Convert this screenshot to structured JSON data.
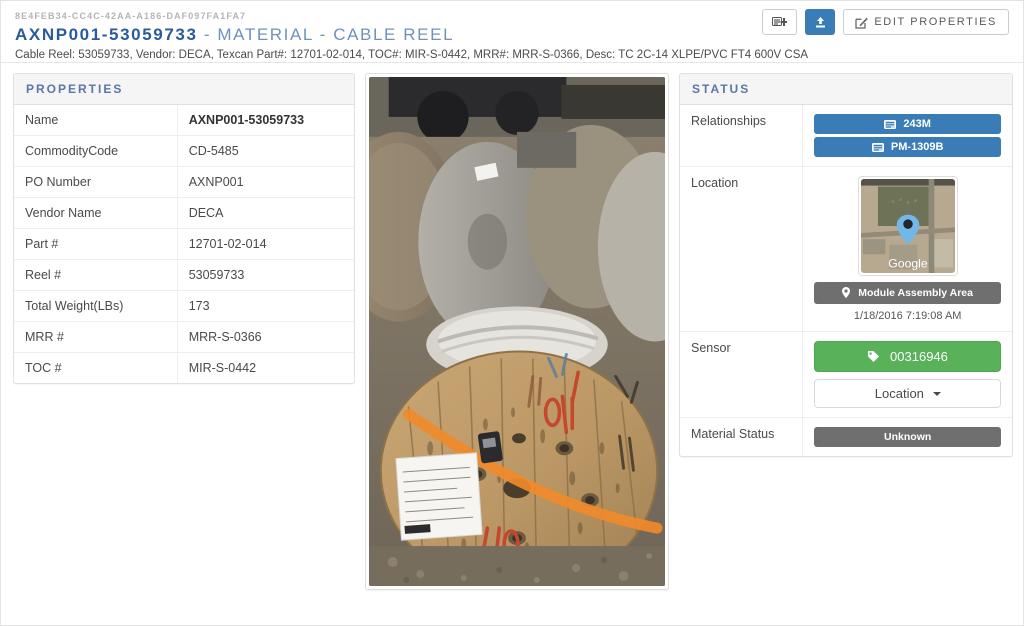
{
  "header": {
    "guid": "8E4FEB34-CC4C-42AA-A186-DAF097FA1FA7",
    "title_main": "AXNP001-53059733",
    "title_sub": " - MATERIAL - CABLE REEL",
    "subtitle": "Cable Reel: 53059733, Vendor: DECA, Texcan Part#: 12701-02-014, TOC#: MIR-S-0442, MRR#: MRR-S-0366, Desc: TC 2C-14 XLPE/PVC FT4 600V CSA",
    "actions": {
      "add_note_icon": "list-add-icon",
      "upload_icon": "upload-icon",
      "edit_icon": "edit-square-icon",
      "edit_label": "EDIT PROPERTIES"
    }
  },
  "properties": {
    "panel_title": "PROPERTIES",
    "rows": [
      {
        "key": "Name",
        "value": "AXNP001-53059733",
        "bold": true
      },
      {
        "key": "CommodityCode",
        "value": "CD-5485",
        "bold": false
      },
      {
        "key": "PO Number",
        "value": "AXNP001",
        "bold": false
      },
      {
        "key": "Vendor Name",
        "value": "DECA",
        "bold": false
      },
      {
        "key": "Part #",
        "value": "12701-02-014",
        "bold": false
      },
      {
        "key": "Reel #",
        "value": "53059733",
        "bold": false
      },
      {
        "key": "Total Weight(LBs)",
        "value": "173",
        "bold": false
      },
      {
        "key": "MRR #",
        "value": "MRR-S-0366",
        "bold": false
      },
      {
        "key": "TOC #",
        "value": "MIR-S-0442",
        "bold": false
      }
    ]
  },
  "photo": {
    "alt": "Wooden cable reel lying flat in a storage yard with orange paint stripe, paper tag and sensor"
  },
  "status": {
    "panel_title": "STATUS",
    "relationships": {
      "label": "Relationships",
      "items": [
        {
          "icon": "id-card-icon",
          "label": "243M"
        },
        {
          "icon": "id-card-icon",
          "label": "PM-1309B"
        }
      ]
    },
    "location": {
      "label": "Location",
      "map_watermark": "Google",
      "map_icon": "map-marker-icon",
      "area_icon": "map-pin-icon",
      "area_label": "Module Assembly Area",
      "timestamp": "1/18/2016 7:19:08 AM"
    },
    "sensor": {
      "label": "Sensor",
      "tag_icon": "tag-icon",
      "tag_label": "00316946",
      "dropdown_label": "Location"
    },
    "material_status": {
      "label": "Material Status",
      "value": "Unknown"
    }
  },
  "colors": {
    "primary_blue": "#3a7cb5",
    "title_blue": "#2a5b9b",
    "success_green": "#59b159",
    "neutral_gray": "#6f6f6f",
    "panel_head_bg": "#f5f5f5",
    "panel_head_text": "#5878a6"
  }
}
